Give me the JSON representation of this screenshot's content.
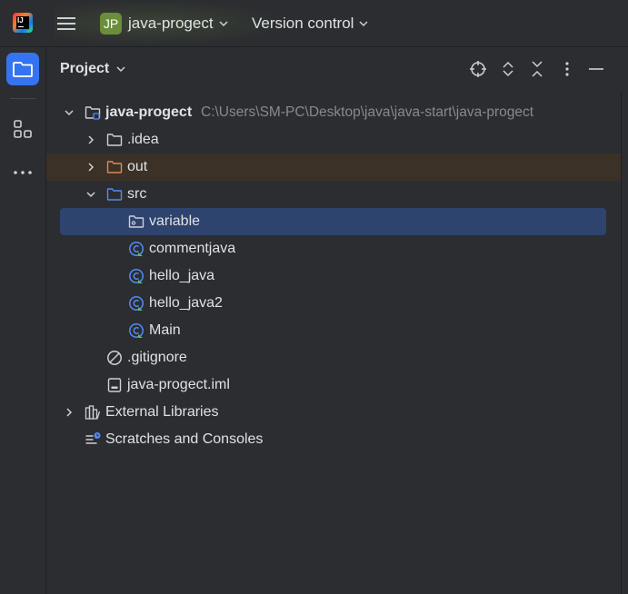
{
  "titlebar": {
    "project_badge": "JP",
    "project_name": "java-progect",
    "vcs_label": "Version control"
  },
  "panel": {
    "title": "Project"
  },
  "tree": {
    "root": {
      "label": "java-progect",
      "path": "C:\\Users\\SM-PC\\Desktop\\java\\java-start\\java-progect"
    },
    "idea": {
      "label": ".idea"
    },
    "out": {
      "label": "out"
    },
    "src": {
      "label": "src"
    },
    "variable": {
      "label": "variable"
    },
    "files": [
      {
        "label": "commentjava"
      },
      {
        "label": "hello_java"
      },
      {
        "label": "hello_java2"
      },
      {
        "label": "Main"
      }
    ],
    "gitignore": {
      "label": ".gitignore"
    },
    "iml": {
      "label": "java-progect.iml"
    },
    "external_libraries": {
      "label": "External Libraries"
    },
    "scratches": {
      "label": "Scratches and Consoles"
    }
  },
  "colors": {
    "background": "#2b2d30",
    "accent": "#3574f0",
    "selected_row": "#2e436e",
    "excluded_row": "#3b3127",
    "badge": "#6b8e3a"
  }
}
